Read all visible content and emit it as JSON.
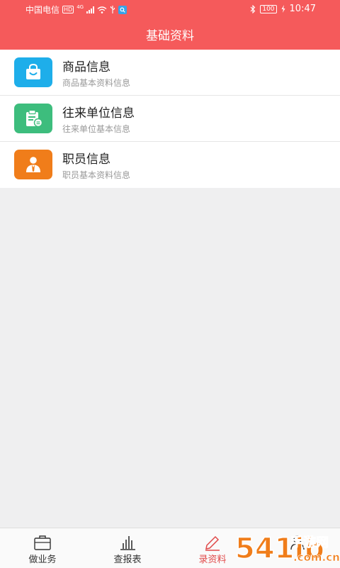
{
  "status_bar": {
    "carrier": "中国电信",
    "hd_badge": "HD",
    "network": "4G",
    "battery": "100",
    "time": "10:47"
  },
  "header": {
    "title": "基础资料"
  },
  "menu": [
    {
      "title": "商品信息",
      "subtitle": "商品基本资料信息",
      "icon": "shopping-bag-icon",
      "color": "#1eaeea"
    },
    {
      "title": "往来单位信息",
      "subtitle": "往来单位基本信息",
      "icon": "clipboard-icon",
      "color": "#3dbd7d"
    },
    {
      "title": "职员信息",
      "subtitle": "职员基本资料信息",
      "icon": "staff-icon",
      "color": "#f07d1a"
    }
  ],
  "tabbar": [
    {
      "label": "做业务",
      "icon": "briefcase-icon",
      "active": false
    },
    {
      "label": "查报表",
      "icon": "bar-chart-icon",
      "active": false
    },
    {
      "label": "录资料",
      "icon": "pen-icon",
      "active": true
    },
    {
      "label": "",
      "icon": "user-icon",
      "active": false
    }
  ],
  "watermark": {
    "text": "541ib",
    "subtext": "手游网",
    "domain": ".com.cn"
  },
  "colors": {
    "primary": "#f55a5b",
    "active_tab": "#e04a4a",
    "background": "#efeff0"
  }
}
